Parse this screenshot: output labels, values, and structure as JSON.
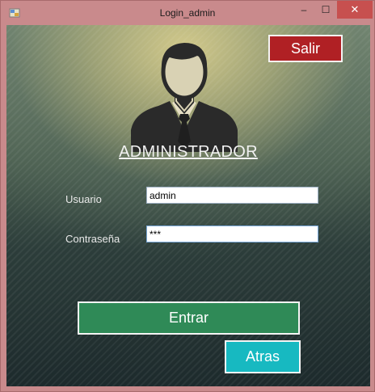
{
  "window": {
    "title": "Login_admin",
    "controls": {
      "minimize": "–",
      "maximize": "☐",
      "close": "✕"
    }
  },
  "header": {
    "avatar_icon": "admin-avatar-icon",
    "heading": "ADMINISTRADOR",
    "exit_button": "Salir"
  },
  "form": {
    "username_label": "Usuario",
    "username_value": "admin",
    "password_label": "Contraseña",
    "password_value": "***"
  },
  "actions": {
    "login_button": "Entrar",
    "back_button": "Atras"
  },
  "colors": {
    "exit": "#b02024",
    "login": "#2f8a57",
    "back": "#17b9c1",
    "close": "#c7504f"
  }
}
